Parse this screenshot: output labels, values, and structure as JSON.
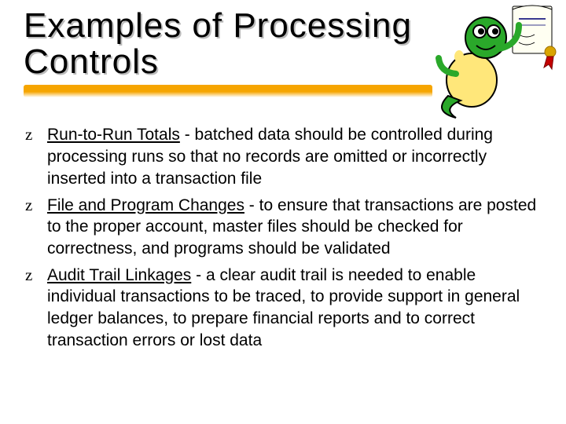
{
  "title": "Examples of Processing Controls",
  "bullets": [
    {
      "term": "Run-to-Run Totals",
      "rest": " - batched data should be controlled during processing runs so that no records are omitted or incorrectly inserted into a transaction file"
    },
    {
      "term": "File and Program Changes",
      "rest": " - to ensure that transactions are posted to the proper account, master files should be checked for correctness, and programs should be validated"
    },
    {
      "term": "Audit Trail Linkages",
      "rest": " - a clear audit trail is needed to enable individual transactions to be traced, to provide support in general ledger balances, to prepare financial reports and to correct transaction errors or lost data"
    }
  ]
}
